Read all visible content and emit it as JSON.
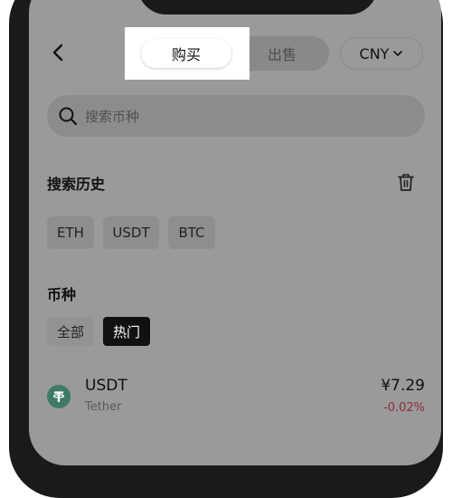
{
  "header": {
    "back_icon": "chevron-left-icon",
    "tabs": {
      "buy": "购买",
      "sell": "出售"
    },
    "currency": {
      "label": "CNY",
      "icon": "chevron-down-icon"
    }
  },
  "search": {
    "placeholder": "搜索币种",
    "icon": "search-icon"
  },
  "history": {
    "title": "搜索历史",
    "delete_icon": "trash-icon",
    "items": [
      "ETH",
      "USDT",
      "BTC"
    ]
  },
  "coins_section": {
    "title": "币种",
    "tabs": [
      {
        "label": "全部",
        "active": false
      },
      {
        "label": "热门",
        "active": true
      }
    ],
    "list": [
      {
        "symbol": "USDT",
        "name": "Tether",
        "price": "¥7.29",
        "change": "-0.02%",
        "change_color": "#8b2d3c",
        "logo_color": "#3f7a66"
      }
    ]
  },
  "colors": {
    "screen_bg": "#9a9a9a",
    "highlight": "#ffffff",
    "active_tab": "#111111"
  }
}
